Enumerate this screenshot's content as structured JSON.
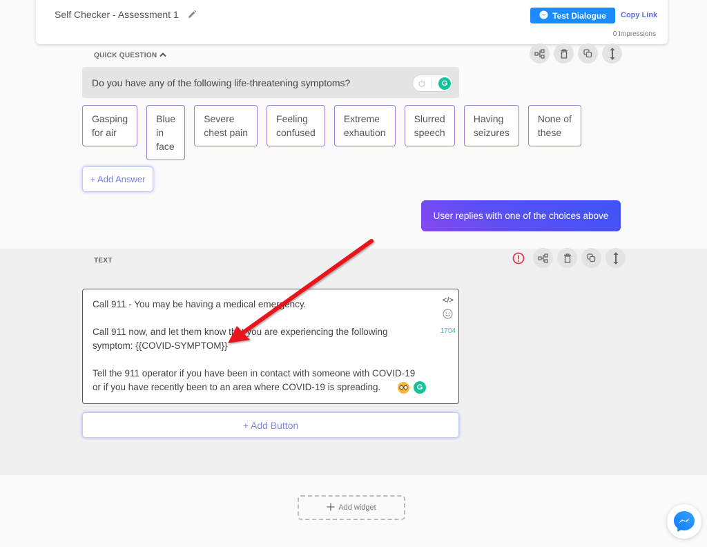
{
  "header": {
    "title": "Self Checker - Assessment 1",
    "test_button_label": "Test Dialogue",
    "copy_link_label": "Copy Link",
    "impressions": "0 Impressions"
  },
  "quick_question": {
    "section_label": "QUICK QUESTION",
    "question": "Do you have any of the following life-threatening symptoms?",
    "answers": [
      {
        "line1": "Gasping",
        "line2": "for air",
        "line3": ""
      },
      {
        "line1": "Blue",
        "line2": "in",
        "line3": "face"
      },
      {
        "line1": "Severe",
        "line2": "chest pain",
        "line3": ""
      },
      {
        "line1": "Feeling",
        "line2": "confused",
        "line3": ""
      },
      {
        "line1": "Extreme",
        "line2": "exhaution",
        "line3": ""
      },
      {
        "line1": "Slurred",
        "line2": "speech",
        "line3": ""
      },
      {
        "line1": "Having",
        "line2": "seizures",
        "line3": ""
      },
      {
        "line1": "None of",
        "line2": "these",
        "line3": ""
      }
    ],
    "add_answer_label": "+ Add Answer",
    "user_reply_label": "User replies with one of the choices above"
  },
  "text_widget": {
    "section_label": "TEXT",
    "paragraph1": "Call 911 - You may be having a medical emergency.",
    "paragraph2_line1": "Call 911 now, and let them know that you are experiencing the following",
    "paragraph2_line2": "symptom: {{COVID-SYMPTOM}}",
    "paragraph3_line1": "Tell the 911 operator if you have been in contact with someone with COVID-19",
    "paragraph3_line2": "or if you have recently been to an area where COVID-19 is spreading.",
    "code_label": "</>",
    "char_count": "1704",
    "add_button_label": "+ Add Button"
  },
  "footer": {
    "add_widget_label": "Add widget"
  },
  "colors": {
    "accent_blue": "#1a8cff",
    "answer_border": "#9a7fd0",
    "grammarly_green": "#15c39a",
    "alert_red": "#e53950",
    "annotation_arrow": "#e8141b"
  }
}
